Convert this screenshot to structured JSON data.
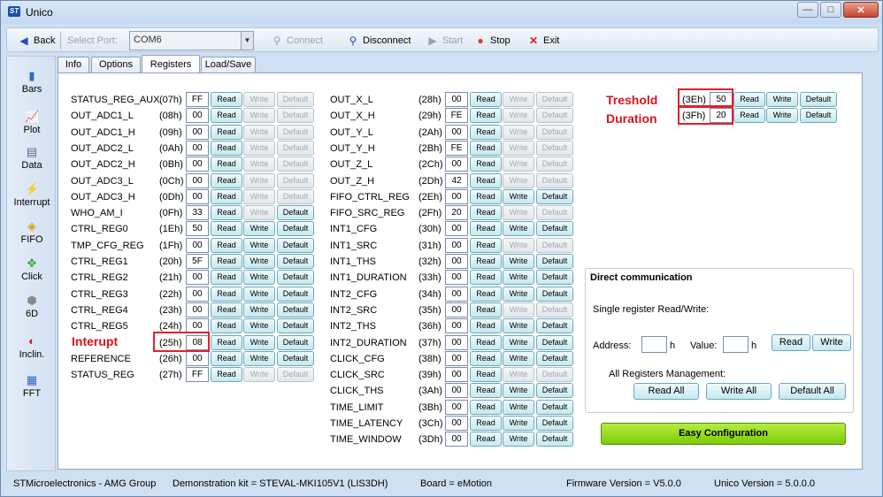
{
  "window": {
    "title": "Unico",
    "logo": "ST",
    "buttons": {
      "minimize": "—",
      "maximize": "□",
      "close": "✕"
    }
  },
  "toolbar": {
    "back": "Back",
    "select_port_label": "Select Port:",
    "port_value": "COM6",
    "connect": "Connect",
    "disconnect": "Disconnect",
    "start": "Start",
    "stop": "Stop",
    "exit": "Exit"
  },
  "sidebar": [
    {
      "label": "Bars",
      "icon": "bars-icon",
      "glyph": "▮"
    },
    {
      "label": "Plot",
      "icon": "plot-icon",
      "glyph": "📈"
    },
    {
      "label": "Data",
      "icon": "data-icon",
      "glyph": "▤"
    },
    {
      "label": "Interrupt",
      "icon": "interrupt-icon",
      "glyph": "⚡"
    },
    {
      "label": "FIFO",
      "icon": "fifo-icon",
      "glyph": "◈"
    },
    {
      "label": "Click",
      "icon": "click-icon",
      "glyph": "✥"
    },
    {
      "label": "6D",
      "icon": "6d-icon",
      "glyph": "⬢"
    },
    {
      "label": "Inclin.",
      "icon": "inclination-icon",
      "glyph": "◐"
    },
    {
      "label": "FFT",
      "icon": "fft-icon",
      "glyph": "▦"
    }
  ],
  "tabs": [
    {
      "label": "Info"
    },
    {
      "label": "Options"
    },
    {
      "label": "Registers"
    },
    {
      "label": "Load/Save"
    }
  ],
  "buttons": {
    "read": "Read",
    "write": "Write",
    "default": "Default"
  },
  "registers_left": [
    {
      "name": "STATUS_REG_AUX",
      "addr": "(07h)",
      "value": "FF",
      "w": false,
      "d": false
    },
    {
      "name": "OUT_ADC1_L",
      "addr": "(08h)",
      "value": "00",
      "w": false,
      "d": false
    },
    {
      "name": "OUT_ADC1_H",
      "addr": "(09h)",
      "value": "00",
      "w": false,
      "d": false
    },
    {
      "name": "OUT_ADC2_L",
      "addr": "(0Ah)",
      "value": "00",
      "w": false,
      "d": false
    },
    {
      "name": "OUT_ADC2_H",
      "addr": "(0Bh)",
      "value": "00",
      "w": false,
      "d": false
    },
    {
      "name": "OUT_ADC3_L",
      "addr": "(0Ch)",
      "value": "00",
      "w": false,
      "d": false
    },
    {
      "name": "OUT_ADC3_H",
      "addr": "(0Dh)",
      "value": "00",
      "w": false,
      "d": false
    },
    {
      "name": "WHO_AM_I",
      "addr": "(0Fh)",
      "value": "33",
      "w": false,
      "d": true
    },
    {
      "name": "CTRL_REG0",
      "addr": "(1Eh)",
      "value": "50",
      "w": true,
      "d": true
    },
    {
      "name": "TMP_CFG_REG",
      "addr": "(1Fh)",
      "value": "00",
      "w": true,
      "d": true
    },
    {
      "name": "CTRL_REG1",
      "addr": "(20h)",
      "value": "5F",
      "w": true,
      "d": true
    },
    {
      "name": "CTRL_REG2",
      "addr": "(21h)",
      "value": "00",
      "w": true,
      "d": true
    },
    {
      "name": "CTRL_REG3",
      "addr": "(22h)",
      "value": "00",
      "w": true,
      "d": true
    },
    {
      "name": "CTRL_REG4",
      "addr": "(23h)",
      "value": "00",
      "w": true,
      "d": true
    },
    {
      "name": "CTRL_REG5",
      "addr": "(24h)",
      "value": "00",
      "w": true,
      "d": true
    },
    {
      "name": "",
      "addr": "(25h)",
      "value": "08",
      "w": true,
      "d": true
    },
    {
      "name": "REFERENCE",
      "addr": "(26h)",
      "value": "00",
      "w": true,
      "d": true
    },
    {
      "name": "STATUS_REG",
      "addr": "(27h)",
      "value": "FF",
      "w": false,
      "d": false
    }
  ],
  "registers_right": [
    {
      "name": "OUT_X_L",
      "addr": "(28h)",
      "value": "00",
      "w": false,
      "d": false
    },
    {
      "name": "OUT_X_H",
      "addr": "(29h)",
      "value": "FE",
      "w": false,
      "d": false
    },
    {
      "name": "OUT_Y_L",
      "addr": "(2Ah)",
      "value": "00",
      "w": false,
      "d": false
    },
    {
      "name": "OUT_Y_H",
      "addr": "(2Bh)",
      "value": "FE",
      "w": false,
      "d": false
    },
    {
      "name": "OUT_Z_L",
      "addr": "(2Ch)",
      "value": "00",
      "w": false,
      "d": false
    },
    {
      "name": "OUT_Z_H",
      "addr": "(2Dh)",
      "value": "42",
      "w": false,
      "d": false
    },
    {
      "name": "FIFO_CTRL_REG",
      "addr": "(2Eh)",
      "value": "00",
      "w": true,
      "d": true
    },
    {
      "name": "FIFO_SRC_REG",
      "addr": "(2Fh)",
      "value": "20",
      "w": false,
      "d": false
    },
    {
      "name": "INT1_CFG",
      "addr": "(30h)",
      "value": "00",
      "w": true,
      "d": true
    },
    {
      "name": "INT1_SRC",
      "addr": "(31h)",
      "value": "00",
      "w": false,
      "d": false
    },
    {
      "name": "INT1_THS",
      "addr": "(32h)",
      "value": "00",
      "w": true,
      "d": true
    },
    {
      "name": "INT1_DURATION",
      "addr": "(33h)",
      "value": "00",
      "w": true,
      "d": true
    },
    {
      "name": "INT2_CFG",
      "addr": "(34h)",
      "value": "00",
      "w": true,
      "d": true
    },
    {
      "name": "INT2_SRC",
      "addr": "(35h)",
      "value": "00",
      "w": false,
      "d": false
    },
    {
      "name": "INT2_THS",
      "addr": "(36h)",
      "value": "00",
      "w": true,
      "d": true
    },
    {
      "name": "INT2_DURATION",
      "addr": "(37h)",
      "value": "00",
      "w": true,
      "d": true
    },
    {
      "name": "CLICK_CFG",
      "addr": "(38h)",
      "value": "00",
      "w": true,
      "d": true
    },
    {
      "name": "CLICK_SRC",
      "addr": "(39h)",
      "value": "00",
      "w": false,
      "d": false
    },
    {
      "name": "CLICK_THS",
      "addr": "(3Ah)",
      "value": "00",
      "w": true,
      "d": true
    },
    {
      "name": "TIME_LIMIT",
      "addr": "(3Bh)",
      "value": "00",
      "w": true,
      "d": true
    },
    {
      "name": "TIME_LATENCY",
      "addr": "(3Ch)",
      "value": "00",
      "w": true,
      "d": true
    },
    {
      "name": "TIME_WINDOW",
      "addr": "(3Dh)",
      "value": "00",
      "w": true,
      "d": true
    }
  ],
  "registers_extra": [
    {
      "addr": "(3Eh)",
      "value": "50",
      "w": true,
      "d": true
    },
    {
      "addr": "(3Fh)",
      "value": "20",
      "w": true,
      "d": true
    }
  ],
  "annotations": {
    "threshold": "Treshold",
    "duration": "Duration",
    "interrupt": "Interupt"
  },
  "direct": {
    "title": "Direct communication",
    "single": "Single register Read/Write:",
    "address_label": "Address:",
    "value_label": "Value:",
    "h": "h",
    "read": "Read",
    "write": "Write",
    "all_label": "All Registers Management:",
    "read_all": "Read All",
    "write_all": "Write All",
    "default_all": "Default All"
  },
  "easy_config": "Easy Configuration",
  "status": {
    "company": "STMicroelectronics - AMG Group",
    "kit": "Demonstration kit = STEVAL-MKI105V1 (LIS3DH)",
    "board": "Board = eMotion",
    "firmware": "Firmware Version = V5.0.0",
    "unico": "Unico Version = 5.0.0.0"
  },
  "colors": {
    "accent_red": "#d4141e",
    "easy_green": "#8fd81a",
    "read_button": "#c5e9ef"
  }
}
